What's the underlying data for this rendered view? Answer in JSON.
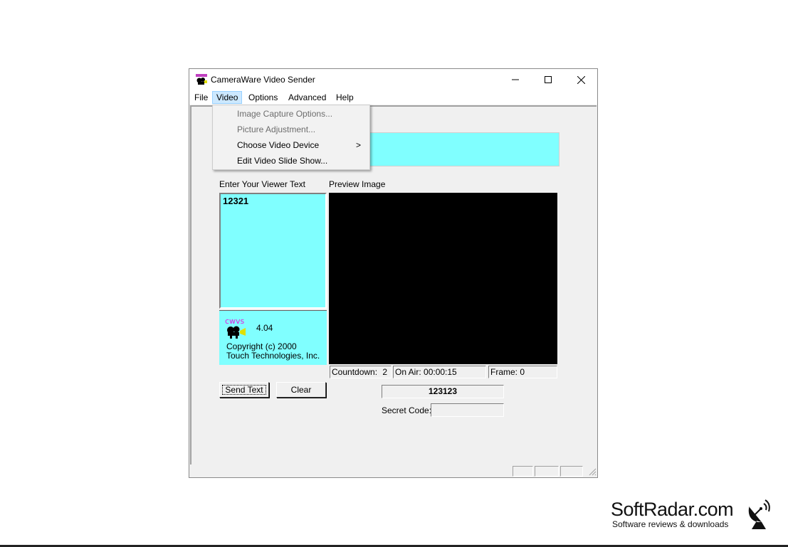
{
  "window": {
    "title": "CameraWare Video Sender",
    "app_icon": "cameraware-icon",
    "controls": {
      "minimize": "minimize-icon",
      "maximize": "maximize-icon",
      "close": "close-icon"
    }
  },
  "menubar": {
    "items": [
      {
        "label": "File"
      },
      {
        "label": "Video",
        "active": true
      },
      {
        "label": "Options"
      },
      {
        "label": "Advanced"
      },
      {
        "label": "Help"
      }
    ]
  },
  "video_menu": {
    "items": [
      {
        "label": "Image Capture Options...",
        "enabled": false
      },
      {
        "label": "Picture Adjustment...",
        "enabled": false
      },
      {
        "label": "Choose Video Device",
        "enabled": true,
        "submenu_arrow": ">"
      },
      {
        "label": "Edit Video Slide Show...",
        "enabled": true
      }
    ]
  },
  "main": {
    "viewer_text_label": "Enter Your Viewer Text",
    "viewer_text_value": "12321",
    "preview_label": "Preview Image",
    "about": {
      "logo_text": "cwvs",
      "version": "4.04",
      "copyright": "Copyright (c) 2000",
      "company": "Touch Technologies, Inc."
    },
    "status": {
      "countdown_label": "Countdown:",
      "countdown_value": "2",
      "on_air": "On Air: 00:00:15",
      "frame": "Frame: 0"
    },
    "buttons": {
      "send_text": "Send Text",
      "clear": "Clear"
    },
    "code_display": "123123",
    "secret_code_label": "Secret Code:",
    "secret_code_value": ""
  },
  "colors": {
    "viewer_background": "#80ffff",
    "menu_highlight": "#cce8ff",
    "preview_background": "#000000"
  },
  "watermark": {
    "name": "SoftRadar.com",
    "tagline": "Software reviews & downloads",
    "icon": "satellite-dish-icon"
  }
}
